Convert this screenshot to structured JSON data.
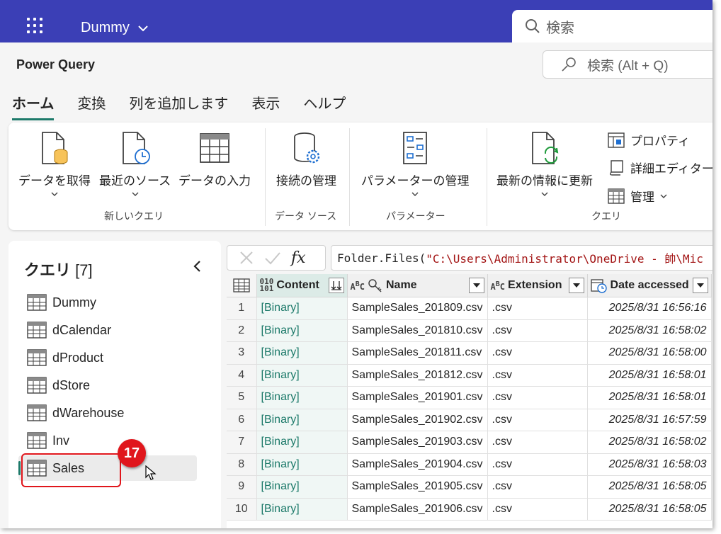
{
  "topbar": {
    "workspace": "Dummy",
    "search_placeholder": "検索"
  },
  "app": {
    "title": "Power Query",
    "search_placeholder": "検索 (Alt + Q)"
  },
  "tabs": [
    {
      "label": "ホーム",
      "active": true
    },
    {
      "label": "変換"
    },
    {
      "label": "列を追加します"
    },
    {
      "label": "表示"
    },
    {
      "label": "ヘルプ"
    }
  ],
  "ribbon": {
    "get_data": "データを取得",
    "recent_sources": "最近のソース",
    "enter_data": "データの入力",
    "group_new_query": "新しいクエリ",
    "manage_connections": "接続の管理",
    "group_data_source": "データ ソース",
    "manage_parameters": "パラメーターの管理",
    "group_parameters": "パラメーター",
    "refresh": "最新の情報に更新",
    "properties": "プロパティ",
    "advanced_editor": "詳細エディター",
    "manage": "管理",
    "group_query": "クエリ"
  },
  "queries": {
    "title": "クエリ",
    "count": "[7]",
    "items": [
      "Dummy",
      "dCalendar",
      "dProduct",
      "dStore",
      "dWarehouse",
      "Inv",
      "Sales"
    ],
    "selected": "Sales"
  },
  "annotation": {
    "number": "17",
    "color": "#e0161c"
  },
  "formula": {
    "function": "Folder.Files(",
    "string": "\"C:\\Users\\Administrator\\OneDrive - 帥\\Mic"
  },
  "table": {
    "columns": [
      "Content",
      "Name",
      "Extension",
      "Date accessed"
    ],
    "content_type": "010 101",
    "rows": [
      {
        "idx": "1",
        "content": "[Binary]",
        "name": "SampleSales_201809.csv",
        "ext": ".csv",
        "date": "2025/8/31 16:56:16"
      },
      {
        "idx": "2",
        "content": "[Binary]",
        "name": "SampleSales_201810.csv",
        "ext": ".csv",
        "date": "2025/8/31 16:58:02"
      },
      {
        "idx": "3",
        "content": "[Binary]",
        "name": "SampleSales_201811.csv",
        "ext": ".csv",
        "date": "2025/8/31 16:58:00"
      },
      {
        "idx": "4",
        "content": "[Binary]",
        "name": "SampleSales_201812.csv",
        "ext": ".csv",
        "date": "2025/8/31 16:58:01"
      },
      {
        "idx": "5",
        "content": "[Binary]",
        "name": "SampleSales_201901.csv",
        "ext": ".csv",
        "date": "2025/8/31 16:58:01"
      },
      {
        "idx": "6",
        "content": "[Binary]",
        "name": "SampleSales_201902.csv",
        "ext": ".csv",
        "date": "2025/8/31 16:57:59"
      },
      {
        "idx": "7",
        "content": "[Binary]",
        "name": "SampleSales_201903.csv",
        "ext": ".csv",
        "date": "2025/8/31 16:58:02"
      },
      {
        "idx": "8",
        "content": "[Binary]",
        "name": "SampleSales_201904.csv",
        "ext": ".csv",
        "date": "2025/8/31 16:58:03"
      },
      {
        "idx": "9",
        "content": "[Binary]",
        "name": "SampleSales_201905.csv",
        "ext": ".csv",
        "date": "2025/8/31 16:58:05"
      },
      {
        "idx": "10",
        "content": "[Binary]",
        "name": "SampleSales_201906.csv",
        "ext": ".csv",
        "date": "2025/8/31 16:58:05"
      }
    ]
  },
  "colors": {
    "topbar": "#3b3fb6",
    "accent": "#1d7a6a",
    "annotation": "#e0161c"
  }
}
